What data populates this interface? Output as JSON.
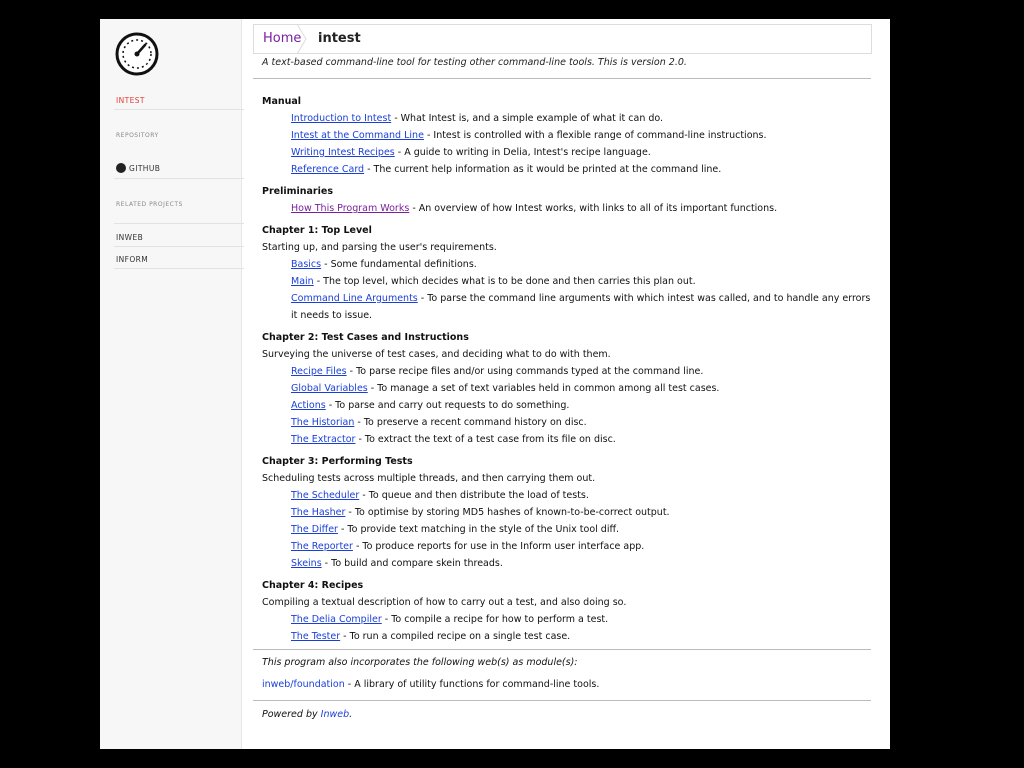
{
  "sidebar": {
    "active_item": "INTEST",
    "repository_heading": "REPOSITORY",
    "github_label": "GITHUB",
    "related_heading": "RELATED PROJECTS",
    "related": [
      "INWEB",
      "INFORM"
    ]
  },
  "breadcrumb": {
    "home": "Home",
    "current": "intest"
  },
  "purpose": "A text-based command-line tool for testing other command-line tools. This is version 2.0.",
  "sections": [
    {
      "title": "Manual",
      "desc": "",
      "items": [
        {
          "link": "Introduction to Intest",
          "text": " - What Intest is, and a simple example of what it can do."
        },
        {
          "link": "Intest at the Command Line",
          "text": " - Intest is controlled with a flexible range of command-line instructions."
        },
        {
          "link": "Writing Intest Recipes",
          "text": " - A guide to writing in Delia, Intest's recipe language."
        },
        {
          "link": "Reference Card",
          "text": " - The current help information as it would be printed at the command line."
        }
      ]
    },
    {
      "title": "Preliminaries",
      "desc": "",
      "items": [
        {
          "link": "How This Program Works",
          "text": " - An overview of how Intest works, with links to all of its important functions."
        }
      ]
    },
    {
      "title": "Chapter 1: Top Level",
      "desc": "Starting up, and parsing the user's requirements.",
      "items": [
        {
          "link": "Basics",
          "text": " - Some fundamental definitions."
        },
        {
          "link": "Main",
          "text": " - The top level, which decides what is to be done and then carries this plan out."
        },
        {
          "link": "Command Line Arguments",
          "text": " - To parse the command line arguments with which intest was called, and to handle any errors it needs to issue."
        }
      ]
    },
    {
      "title": "Chapter 2: Test Cases and Instructions",
      "desc": "Surveying the universe of test cases, and deciding what to do with them.",
      "items": [
        {
          "link": "Recipe Files",
          "text": " - To parse recipe files and/or using commands typed at the command line."
        },
        {
          "link": "Global Variables",
          "text": " - To manage a set of text variables held in common among all test cases."
        },
        {
          "link": "Actions",
          "text": " - To parse and carry out requests to do something."
        },
        {
          "link": "The Historian",
          "text": " - To preserve a recent command history on disc."
        },
        {
          "link": "The Extractor",
          "text": " - To extract the text of a test case from its file on disc."
        }
      ]
    },
    {
      "title": "Chapter 3: Performing Tests",
      "desc": "Scheduling tests across multiple threads, and then carrying them out.",
      "items": [
        {
          "link": "The Scheduler",
          "text": " - To queue and then distribute the load of tests."
        },
        {
          "link": "The Hasher",
          "text": " - To optimise by storing MD5 hashes of known-to-be-correct output."
        },
        {
          "link": "The Differ",
          "text": " - To provide text matching in the style of the Unix tool diff."
        },
        {
          "link": "The Reporter",
          "text": " - To produce reports for use in the Inform user interface app."
        },
        {
          "link": "Skeins",
          "text": " - To build and compare skein threads."
        }
      ]
    },
    {
      "title": "Chapter 4: Recipes",
      "desc": "Compiling a textual description of how to carry out a test, and also doing so.",
      "items": [
        {
          "link": "The Delia Compiler",
          "text": " - To compile a recipe for how to perform a test."
        },
        {
          "link": "The Tester",
          "text": " - To run a compiled recipe on a single test case."
        }
      ]
    }
  ],
  "footer": {
    "modules_note": "This program also incorporates the following web(s) as module(s):",
    "module_link": "inweb/foundation",
    "module_text": " - A library of utility functions for command-line tools.",
    "powered_prefix": "Powered by ",
    "powered_link": "Inweb",
    "powered_suffix": "."
  }
}
